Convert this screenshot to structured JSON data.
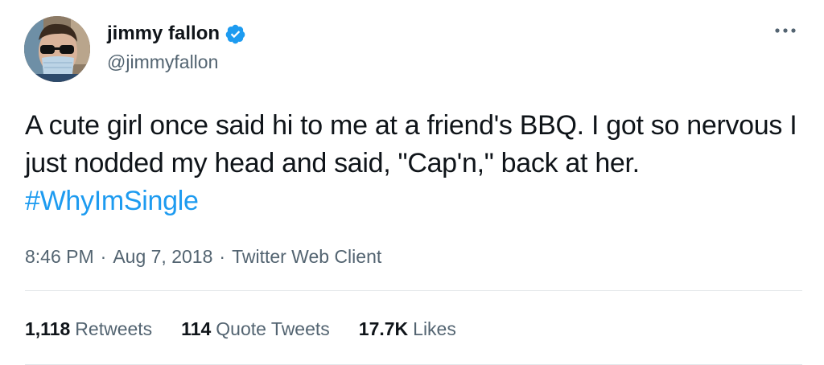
{
  "author": {
    "display_name": "jimmy fallon",
    "handle": "@jimmyfallon",
    "verified_icon": "verified-badge-icon",
    "accent_color": "#1d9bf0"
  },
  "tweet": {
    "text_before": "A cute girl once said hi to me at a friend's BBQ. I got so nervous I just nodded my head and said, \"Cap'n,\" back at her. ",
    "hashtag": "#WhyImSingle"
  },
  "meta": {
    "time": "8:46 PM",
    "separator": "·",
    "date": "Aug 7, 2018",
    "source": "Twitter Web Client"
  },
  "stats": {
    "retweets_count": "1,118",
    "retweets_label": "Retweets",
    "quotes_count": "114",
    "quotes_label": "Quote Tweets",
    "likes_count": "17.7K",
    "likes_label": "Likes"
  },
  "more_icon": "more-horizontal-icon"
}
